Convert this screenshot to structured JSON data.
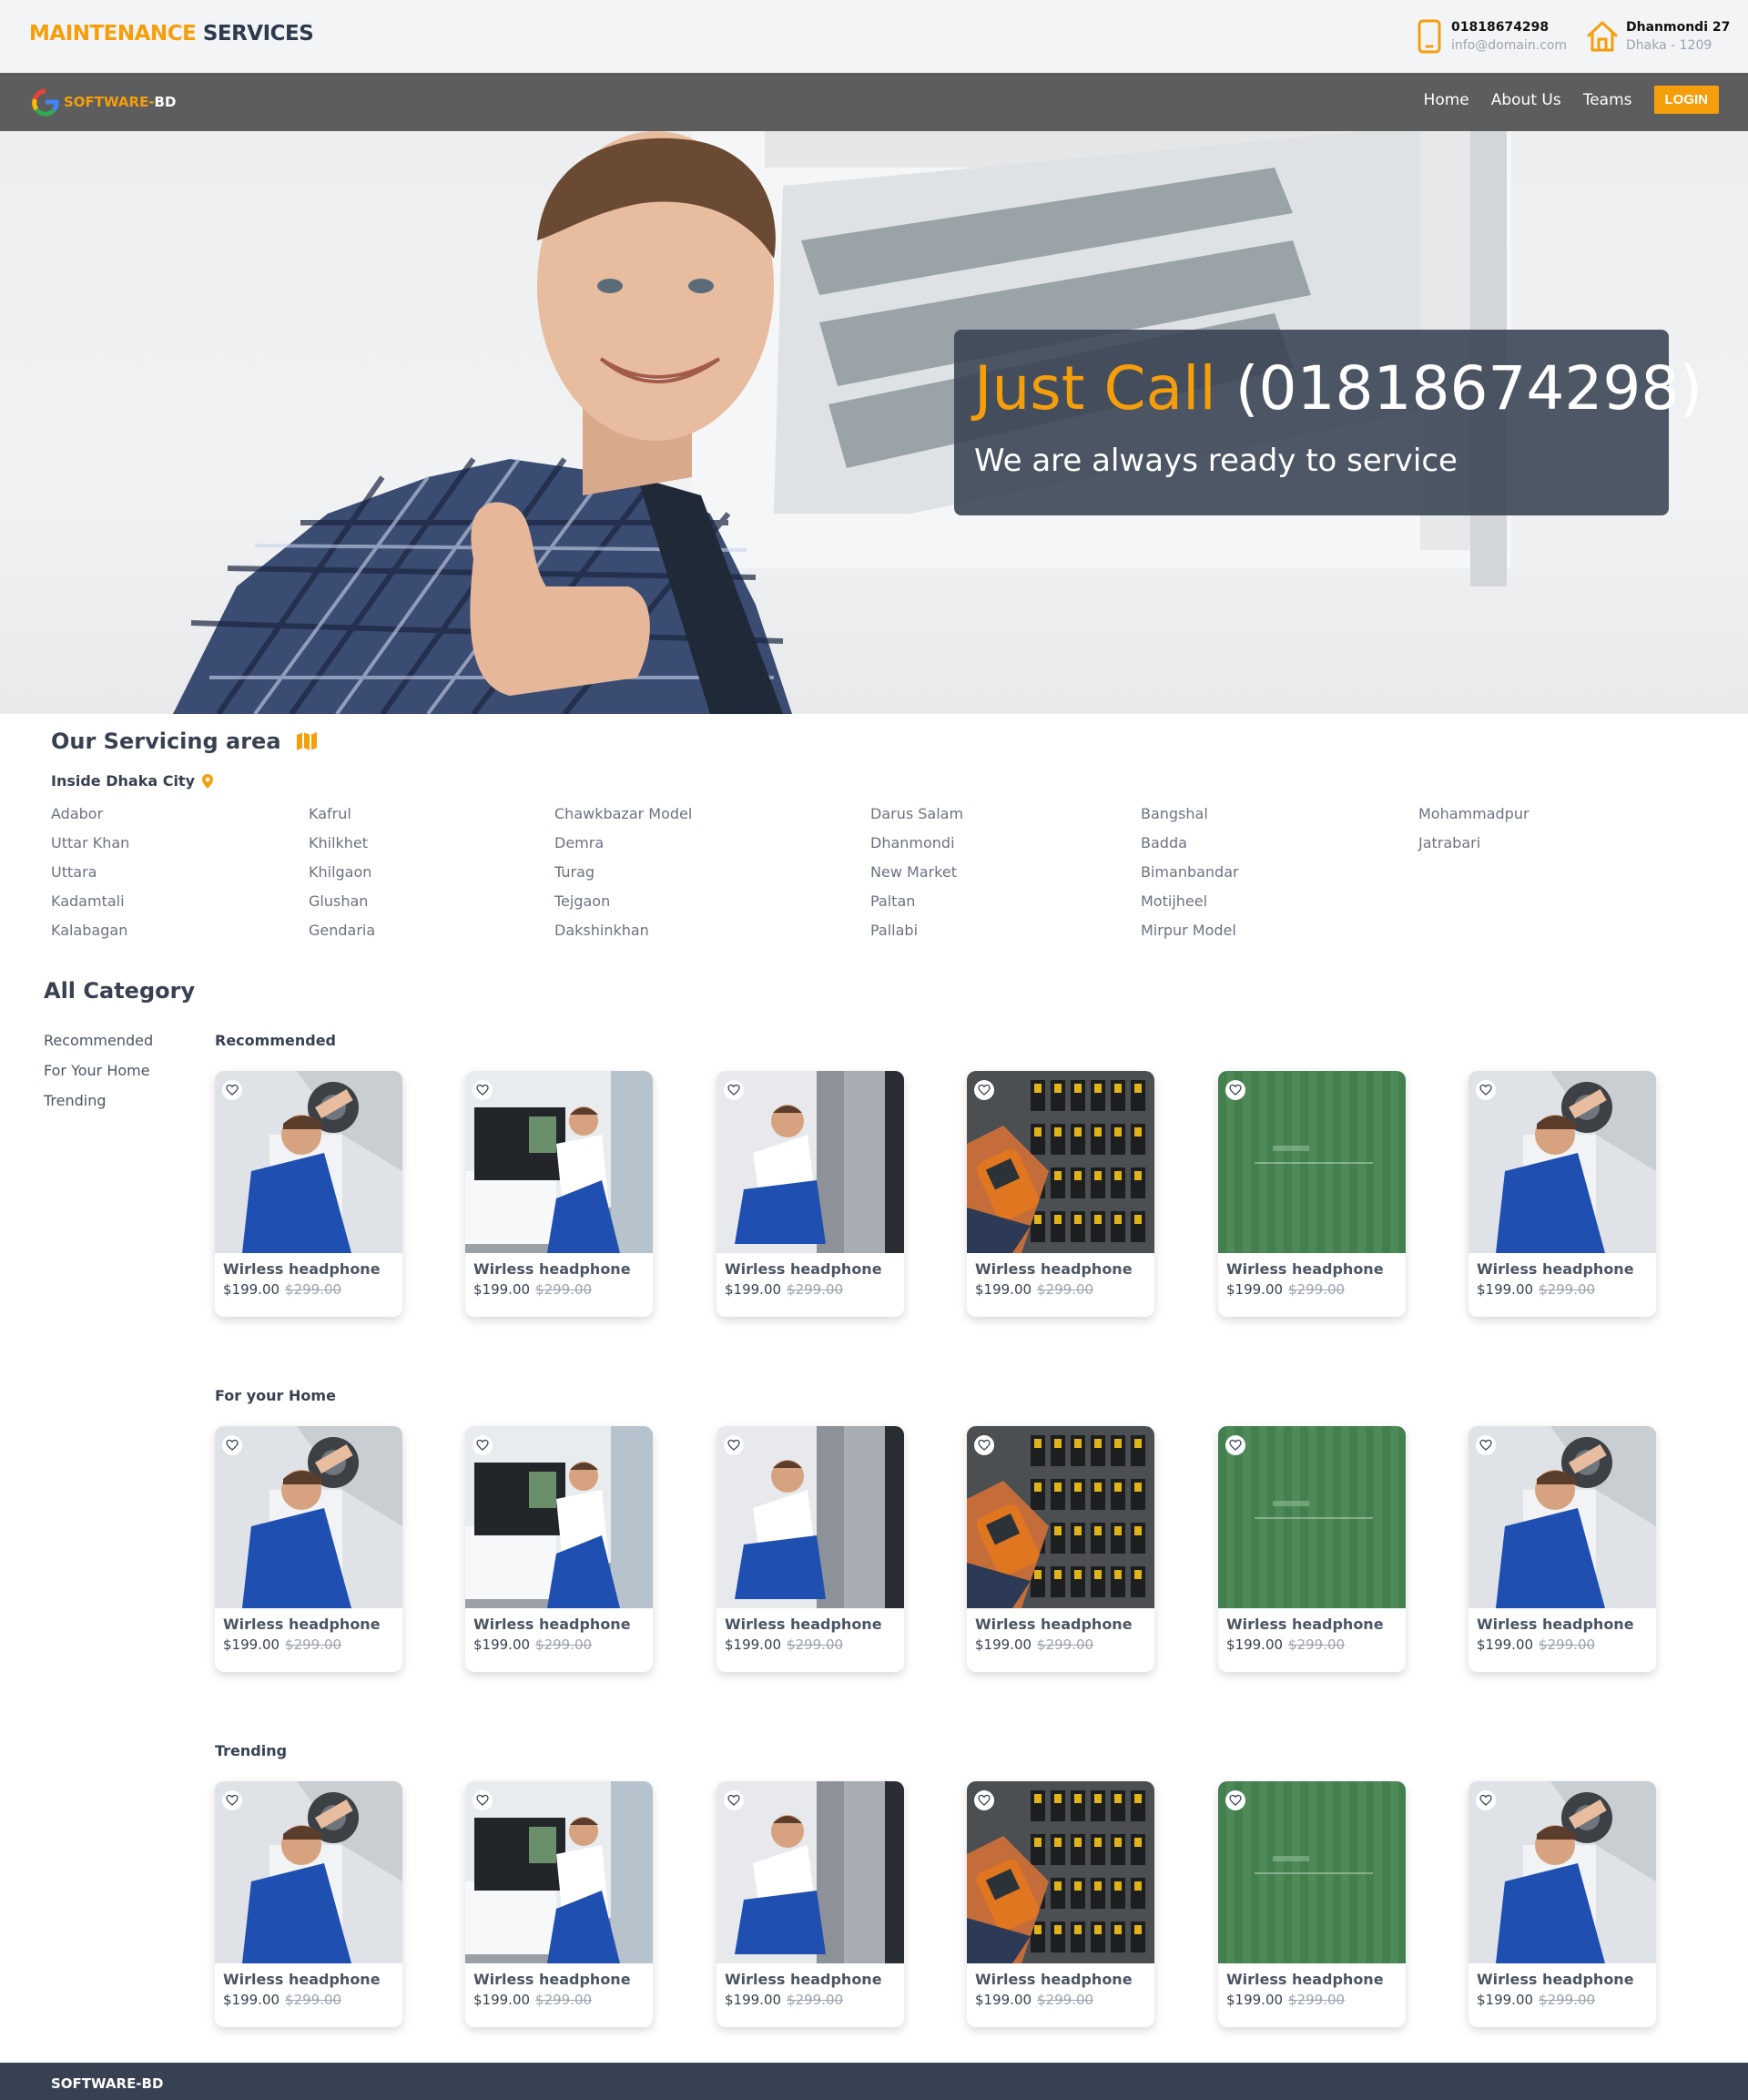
{
  "header": {
    "brand_part1": "MAINTENANCE",
    "brand_part2": "SERVICES",
    "phone": "01818674298",
    "email": "info@domain.com",
    "address_line1": "Dhanmondi 27",
    "address_line2": "Dhaka - 1209",
    "accent_color": "#f59e0b"
  },
  "nav": {
    "logo_part1": "SOFTWARE-",
    "logo_part2": "BD",
    "links": [
      "Home",
      "About Us",
      "Teams"
    ],
    "login_label": "LOGIN",
    "bg_color": "#5d5d5d"
  },
  "hero": {
    "title_highlight": "Just Call",
    "title_number": "(01818674298)",
    "subtitle": "We are always ready to service"
  },
  "servicing_area": {
    "title": "Our Servicing area",
    "subtitle": "Inside Dhaka City",
    "columns": [
      [
        "Adabor",
        "Uttar Khan",
        "Uttara",
        "Kadamtali",
        "Kalabagan"
      ],
      [
        "Kafrul",
        "Khilkhet",
        "Khilgaon",
        "Glushan",
        "Gendaria"
      ],
      [
        "Chawkbazar Model",
        "Demra",
        "Turag",
        "Tejgaon",
        "Dakshinkhan"
      ],
      [
        "Darus Salam",
        "Dhanmondi",
        "New Market",
        "Paltan",
        "Pallabi"
      ],
      [
        "Bangshal",
        "Badda",
        "Bimanbandar",
        "Motijheel",
        "Mirpur Model"
      ],
      [
        "Mohammadpur",
        "Jatrabari"
      ]
    ]
  },
  "category": {
    "title": "All Category",
    "sidebar": [
      "Recommended",
      "For Your Home",
      "Trending"
    ],
    "rows": [
      {
        "title": "Recommended"
      },
      {
        "title": "For your Home"
      },
      {
        "title": "Trending"
      }
    ],
    "card": {
      "title": "Wirless headphone",
      "price": "$199.00",
      "old_price": "$299.00"
    },
    "image_types": [
      "ac-repair",
      "tv-repair",
      "fridge-repair",
      "electrical-panel",
      "green-blur",
      "ac-repair"
    ]
  },
  "footer": {
    "text": "SOFTWARE-BD"
  }
}
